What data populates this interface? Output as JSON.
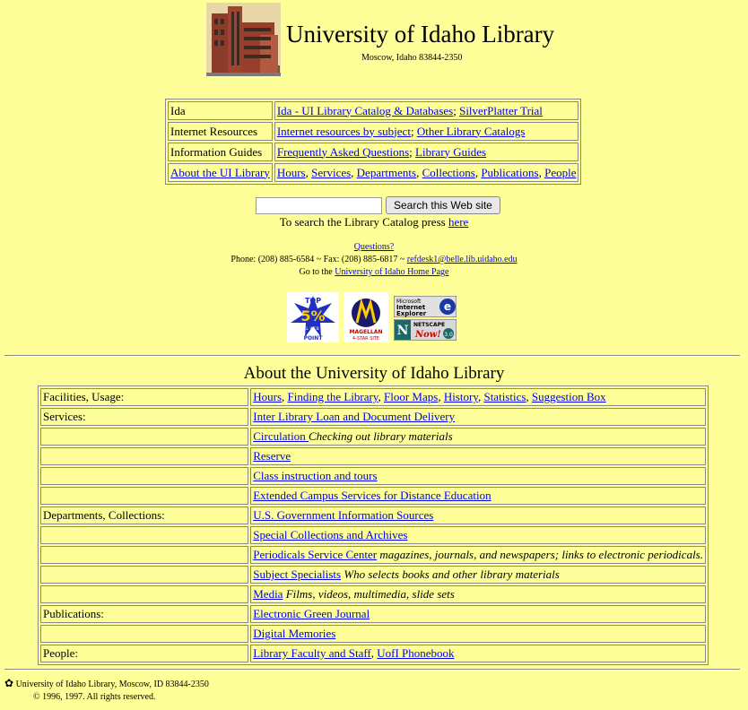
{
  "header": {
    "title": "University of Idaho Library",
    "subtitle": "Moscow, Idaho 83844-2350"
  },
  "top_table": [
    {
      "label": "Ida",
      "links": [
        "Ida - UI Library Catalog & Databases",
        "SilverPlatter Trial"
      ]
    },
    {
      "label": "Internet Resources",
      "links": [
        "Internet resources by subject",
        "Other Library Catalogs"
      ]
    },
    {
      "label": "Information Guides",
      "links": [
        "Frequently Asked Questions",
        "Library Guides"
      ]
    },
    {
      "label": "About the UI Library",
      "label_is_link": true,
      "links": [
        "Hours",
        "Services",
        "Departments",
        "Collections",
        "Publications",
        "People"
      ]
    }
  ],
  "search": {
    "input_value": "",
    "button_label": "Search this Web site",
    "catalog_text": "To search the Library Catalog press",
    "catalog_link": "here"
  },
  "contact": {
    "questions": "Questions?",
    "phone_text": "Phone: (208) 885-6584 ~ Fax: (208) 885-6817 ~",
    "email": "refdesk1@belle.lib.uidaho.edu",
    "goto_text": "Go to the",
    "home_link": "University of Idaho Home Page"
  },
  "badges": {
    "point_line1": "TOP",
    "point_line2": "5%",
    "point_line3": "OF ALL WEB SITES",
    "point_line4": "POINT",
    "magellan_line1": "MAGELLAN",
    "magellan_line2": "4-STAR SITE",
    "ie_line1": "Microsoft",
    "ie_line2": "Internet",
    "ie_line3": "Explorer",
    "ns_line1": "NETSCAPE",
    "ns_line2": "Now!",
    "ns_line3": "3.0"
  },
  "about": {
    "heading": "About the University of Idaho Library",
    "rows": [
      {
        "label": "Facilities, Usage:",
        "links": [
          "Hours",
          "Finding the Library",
          "Floor Maps",
          "History",
          "Statistics",
          "Suggestion Box"
        ],
        "note": ""
      },
      {
        "label": "Services:",
        "links": [
          "Inter Library Loan and Document Delivery"
        ],
        "note": ""
      },
      {
        "label": "",
        "links": [
          "Circulation "
        ],
        "note": "Checking out library materials"
      },
      {
        "label": "",
        "links": [
          "Reserve"
        ],
        "note": ""
      },
      {
        "label": "",
        "links": [
          "Class instruction and tours"
        ],
        "note": ""
      },
      {
        "label": "",
        "links": [
          "Extended Campus Services for Distance Education"
        ],
        "note": ""
      },
      {
        "label": "Departments, Collections:",
        "links": [
          "U.S. Government Information Sources"
        ],
        "note": ""
      },
      {
        "label": "",
        "links": [
          "Special Collections and Archives"
        ],
        "note": ""
      },
      {
        "label": "",
        "links": [
          "Periodicals Service Center"
        ],
        "note": " magazines, journals, and newspapers; links to electronic periodicals."
      },
      {
        "label": "",
        "links": [
          "Subject Specialists"
        ],
        "note": " Who selects books and other library materials"
      },
      {
        "label": "",
        "links": [
          "Media"
        ],
        "note": " Films, videos, multimedia, slide sets"
      },
      {
        "label": "Publications:",
        "links": [
          "Electronic Green Journal"
        ],
        "note": ""
      },
      {
        "label": "",
        "links": [
          "Digital Memories"
        ],
        "note": ""
      },
      {
        "label": "People:",
        "links": [
          "Library Faculty and Staff",
          "UofI Phonebook"
        ],
        "note": ""
      }
    ]
  },
  "footer": {
    "address": "University of Idaho Library, Moscow, ID 83844-2350",
    "copyright": "© 1996, 1997.  All rights reserved."
  }
}
